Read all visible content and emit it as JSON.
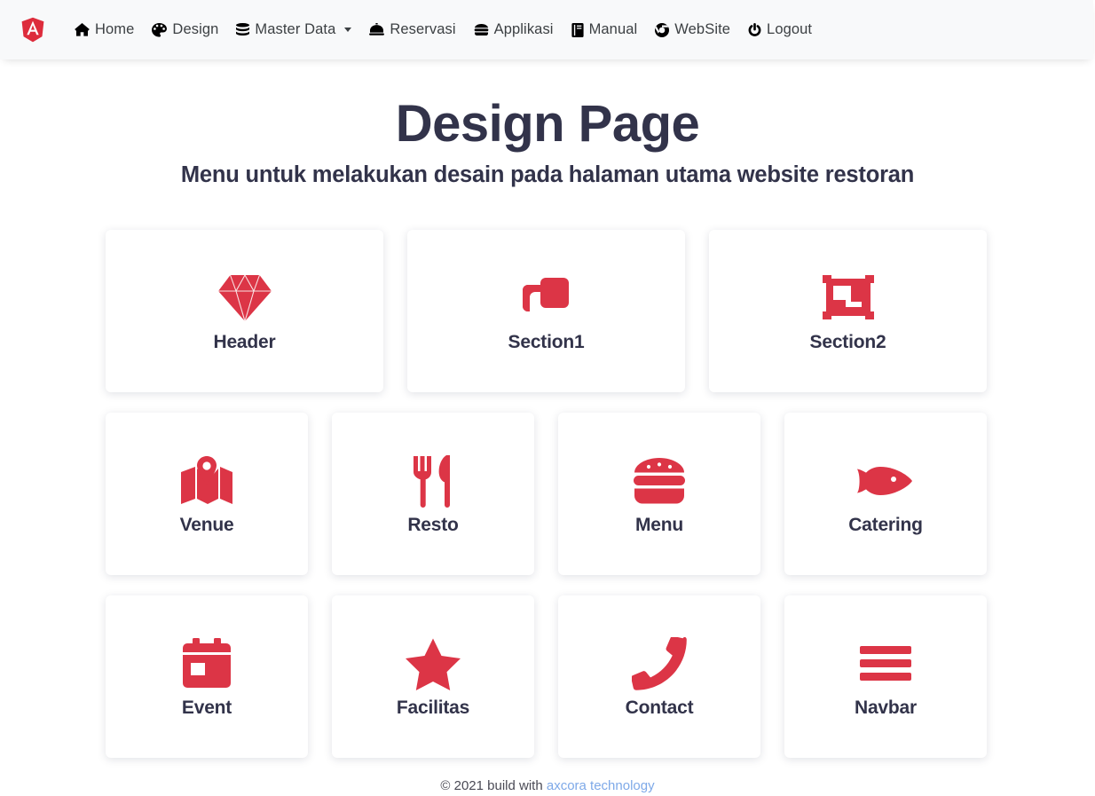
{
  "navbar": {
    "brand": {
      "icon": "angular-logo-icon",
      "letter": "A",
      "color": "#dd2c3c"
    },
    "items": [
      {
        "icon": "home-icon",
        "label": "Home",
        "caret": false
      },
      {
        "icon": "palette-icon",
        "label": "Design",
        "caret": false
      },
      {
        "icon": "database-icon",
        "label": "Master Data",
        "caret": true
      },
      {
        "icon": "concierge-bell-icon",
        "label": "Reservasi",
        "caret": false
      },
      {
        "icon": "hamburger-food-icon",
        "label": "Applikasi",
        "caret": false
      },
      {
        "icon": "book-icon",
        "label": "Manual",
        "caret": false
      },
      {
        "icon": "chrome-icon",
        "label": "WebSite",
        "caret": false
      },
      {
        "icon": "power-icon",
        "label": "Logout",
        "caret": false
      }
    ]
  },
  "page": {
    "title": "Design Page",
    "subtitle": "Menu untuk melakukan desain pada halaman utama website restoran"
  },
  "theme": {
    "accent": "#dc3546",
    "heading": "#32334a",
    "navbar_bg": "#f8f9fa",
    "link": "#7ea9e8"
  },
  "cards": {
    "row1": [
      {
        "icon": "gem-icon",
        "label": "Header"
      },
      {
        "icon": "clone-icon",
        "label": "Section1"
      },
      {
        "icon": "object-group-icon",
        "label": "Section2"
      }
    ],
    "row2": [
      {
        "icon": "map-marked-icon",
        "label": "Venue"
      },
      {
        "icon": "utensils-icon",
        "label": "Resto"
      },
      {
        "icon": "burger-icon",
        "label": "Menu"
      },
      {
        "icon": "fish-icon",
        "label": "Catering"
      }
    ],
    "row3": [
      {
        "icon": "calendar-day-icon",
        "label": "Event"
      },
      {
        "icon": "star-icon",
        "label": "Facilitas"
      },
      {
        "icon": "phone-icon",
        "label": "Contact"
      },
      {
        "icon": "bars-icon",
        "label": "Navbar"
      }
    ]
  },
  "footer": {
    "text": "© 2021 build with",
    "link_label": "axcora technology"
  }
}
